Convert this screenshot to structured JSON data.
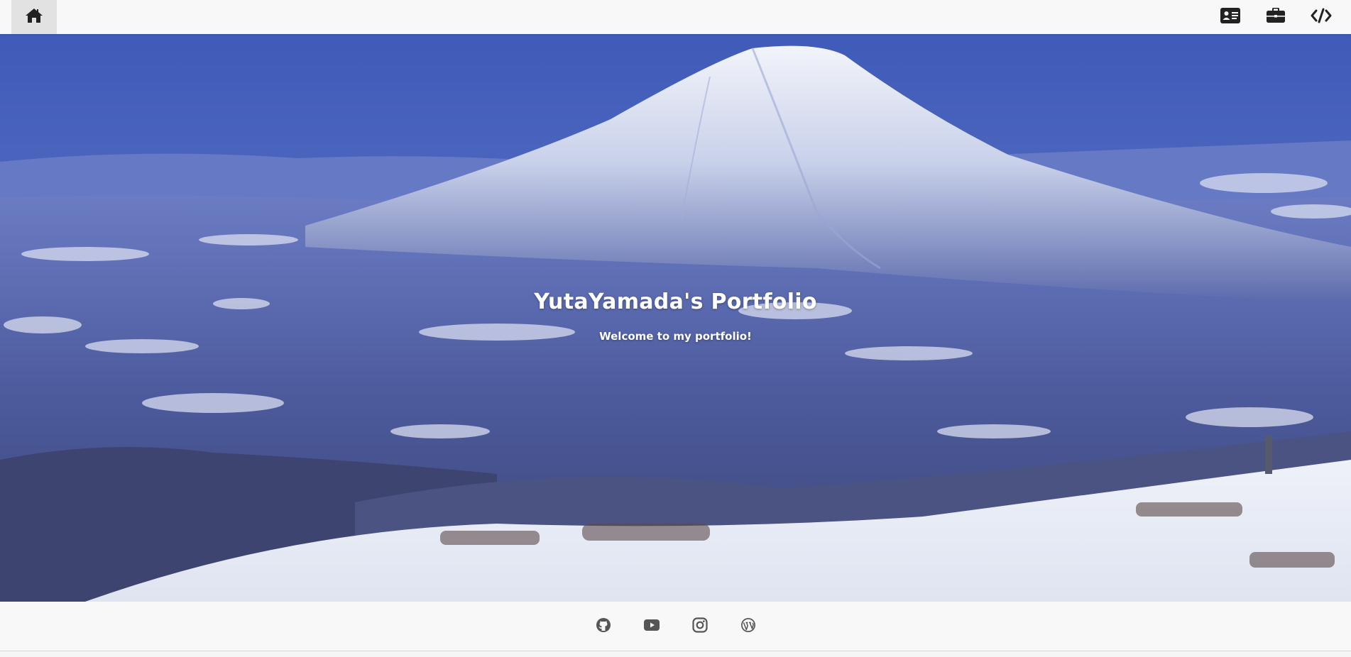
{
  "navbar": {
    "home_icon": "home-icon",
    "right_icons": [
      "id-card-icon",
      "briefcase-icon",
      "code-icon"
    ]
  },
  "hero": {
    "title": "YutaYamada's Portfolio",
    "subtitle": "Welcome to my portfolio!",
    "background": "snow-covered-mountain-photo"
  },
  "footer": {
    "social_icons": [
      "github-icon",
      "youtube-icon",
      "instagram-icon",
      "wordpress-icon"
    ]
  },
  "colors": {
    "navbar_bg": "#f8f8f8",
    "home_active_bg": "#e2e2e2",
    "icon_dark": "#222222",
    "footer_icon": "#555555",
    "sky": "#4a66c2",
    "snow": "#e8ecf6"
  }
}
